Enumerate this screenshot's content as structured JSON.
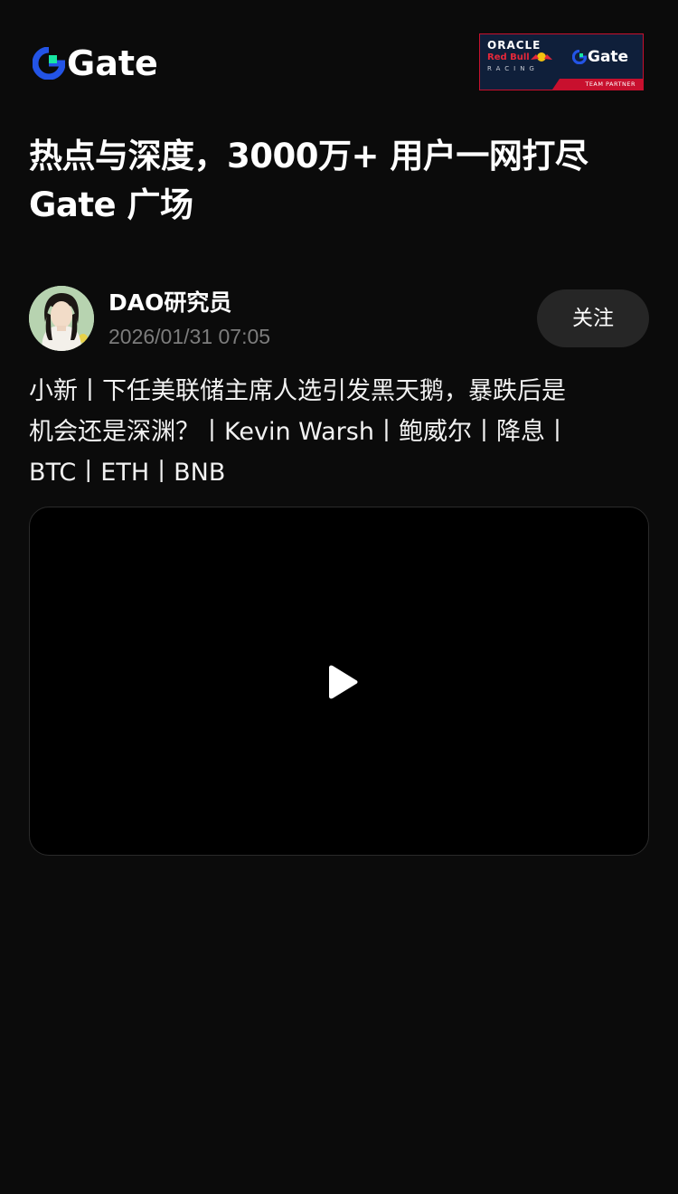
{
  "header": {
    "logo_text": "Gate",
    "partner": {
      "oracle": "ORACLE",
      "redbull": "Red Bull",
      "racing": "RACING",
      "brand": "Gate",
      "badge": "TEAM PARTNER"
    }
  },
  "headline": {
    "line1": "热点与深度，3000万+ 用户一网打尽",
    "line2": "Gate 广场"
  },
  "post": {
    "author_name": "DAO研究员",
    "timestamp": "2026/01/31 07:05",
    "follow_label": "关注",
    "text_line1": "小新丨下任美联储主席人选引发黑天鹅，暴跌后是",
    "text_line2": "机会还是深渊？丨Kevin Warsh丨鲍威尔丨降息丨",
    "text_line3": "BTC丨ETH丨BNB"
  },
  "icons": {
    "logo": "gate-logo-icon",
    "play": "play-icon",
    "avatar": "avatar"
  },
  "colors": {
    "background": "#0b0b0b",
    "brand_blue": "#2354e6",
    "brand_green": "#17e5a1",
    "follow_bg": "#262626",
    "muted_text": "#7c7c7c"
  }
}
